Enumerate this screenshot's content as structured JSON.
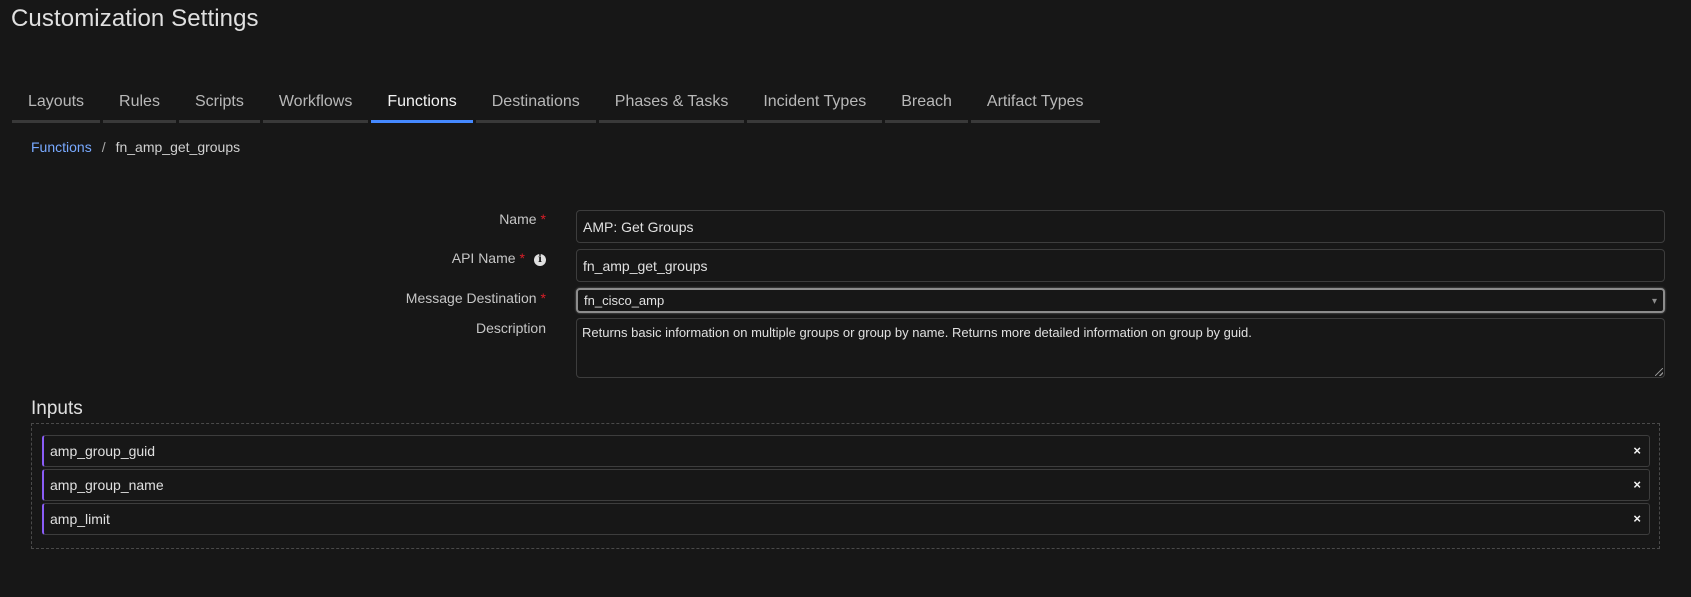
{
  "page": {
    "title": "Customization Settings"
  },
  "tabs": [
    {
      "label": "Layouts",
      "active": false
    },
    {
      "label": "Rules",
      "active": false
    },
    {
      "label": "Scripts",
      "active": false
    },
    {
      "label": "Workflows",
      "active": false
    },
    {
      "label": "Functions",
      "active": true
    },
    {
      "label": "Destinations",
      "active": false
    },
    {
      "label": "Phases & Tasks",
      "active": false
    },
    {
      "label": "Incident Types",
      "active": false
    },
    {
      "label": "Breach",
      "active": false
    },
    {
      "label": "Artifact Types",
      "active": false
    }
  ],
  "breadcrumb": {
    "parent": "Functions",
    "separator": "/",
    "current": "fn_amp_get_groups"
  },
  "form": {
    "name": {
      "label": "Name",
      "required_mark": "*",
      "value": "AMP: Get Groups"
    },
    "api_name": {
      "label": "API Name",
      "required_mark": "*",
      "info_icon": "info-circle-icon",
      "value": "fn_amp_get_groups"
    },
    "message_destination": {
      "label": "Message Destination",
      "required_mark": "*",
      "value": "fn_cisco_amp",
      "arrow": "▾"
    },
    "description": {
      "label": "Description",
      "value": "Returns basic information on multiple groups or group by name. Returns more detailed information on group by guid."
    }
  },
  "inputs": {
    "title": "Inputs",
    "remove_glyph": "×",
    "items": [
      {
        "label": "amp_group_guid"
      },
      {
        "label": "amp_group_name"
      },
      {
        "label": "amp_limit"
      }
    ]
  },
  "colors": {
    "background": "#171717",
    "accent_tab": "#4589ff",
    "link": "#78a9ff",
    "required": "#da1e28",
    "input_marker": "#8a5cf6"
  }
}
